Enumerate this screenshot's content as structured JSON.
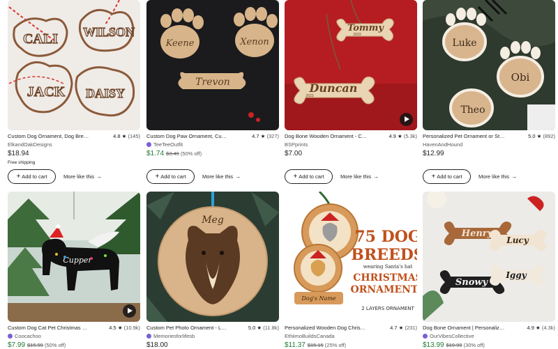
{
  "listings": [
    {
      "title": "Custom Dog Ornament, Dog Bre…",
      "rating": "4.8",
      "review_count": "(145)",
      "shop": "ElkandOakDesigns",
      "star_seller": false,
      "price": "$18.94",
      "original_price": "",
      "discount": "",
      "shipping": "Free shipping",
      "add_to_cart": "Add to cart",
      "more_like_this": "More like this",
      "image_text": [
        "CALI",
        "WILSON",
        "JACK",
        "DAISY"
      ],
      "has_video": false
    },
    {
      "title": "Custom Dog Paw Ornament, Cu…",
      "rating": "4.7",
      "review_count": "(327)",
      "shop": "TeeTeeOutfit",
      "star_seller": true,
      "price": "$1.74",
      "original_price": "$3.49",
      "discount": "(50% off)",
      "shipping": "",
      "add_to_cart": "Add to cart",
      "more_like_this": "More like this",
      "image_text": [
        "Keene",
        "Xenon",
        "Trevon"
      ],
      "has_video": false
    },
    {
      "title": "Dog Bone Wooden Ornament - C…",
      "rating": "4.9",
      "review_count": "(5.3k)",
      "shop": "BSPprints",
      "star_seller": false,
      "price": "$7.00",
      "original_price": "",
      "discount": "",
      "shipping": "",
      "add_to_cart": "Add to cart",
      "more_like_this": "More like this",
      "image_text": [
        "Tommy",
        "2023",
        "Duncan",
        "2023"
      ],
      "has_video": true
    },
    {
      "title": "Personalized Pet Ornament or St…",
      "rating": "5.0",
      "review_count": "(892)",
      "shop": "HavenAndHound",
      "star_seller": false,
      "price": "$12.99",
      "original_price": "",
      "discount": "",
      "shipping": "",
      "add_to_cart": "Add to cart",
      "more_like_this": "More like this",
      "image_text": [
        "Luke",
        "Obi",
        "Theo"
      ],
      "has_video": false
    },
    {
      "title": "Custom Dog Cat Pet Christmas …",
      "rating": "4.5",
      "review_count": "(10.9k)",
      "shop": "Coocachoo",
      "star_seller": true,
      "price": "$7.99",
      "original_price": "$15.99",
      "discount": "(50% off)",
      "shipping": "",
      "image_text": [
        "Cupper"
      ],
      "has_video": true
    },
    {
      "title": "Custom Pet Photo Ornament - L…",
      "rating": "5.0",
      "review_count": "(11.8k)",
      "shop": "Memoriesforlifesb",
      "star_seller": true,
      "price": "$18.00",
      "original_price": "",
      "discount": "",
      "shipping": "",
      "image_text": [
        "Meg"
      ],
      "has_video": false
    },
    {
      "title": "Personalized Wooden Dog Chris…",
      "rating": "4.7",
      "review_count": "(231)",
      "shop": "EthiimoBuildsCanada",
      "star_seller": false,
      "price": "$11.37",
      "original_price": "$15.15",
      "discount": "(25% off)",
      "shipping": "",
      "image_text": [
        "75 DOG",
        "BREEDS",
        "wearing Santa's hat",
        "CHRISTMAS",
        "ORNAMENTS",
        "2 LAYERS ORNAMENT",
        "Dog's Name"
      ],
      "has_video": false
    },
    {
      "title": "Dog Bone Ornament | Personaliz…",
      "rating": "4.9",
      "review_count": "(4.3k)",
      "shop": "OurVibesCollective",
      "star_seller": true,
      "price": "$13.99",
      "original_price": "$19.99",
      "discount": "(30% off)",
      "shipping": "",
      "image_text": [
        "Henry",
        "Lucy",
        "Snowy",
        "Iggy"
      ],
      "has_video": false
    }
  ],
  "colors": {
    "sale_price": "#1f7a33",
    "star_seller_badge": "#7b5fd6",
    "text": "#222222",
    "muted": "#595959"
  },
  "icons": {
    "rating": "star-icon",
    "cart": "plus-icon",
    "more": "arrow-right-icon",
    "video": "play-icon"
  }
}
